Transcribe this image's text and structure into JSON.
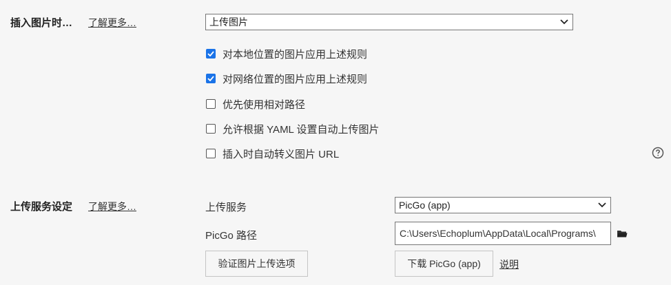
{
  "insert_image": {
    "title": "插入图片时…",
    "learn_more": "了解更多…",
    "action_select": {
      "selected": "上传图片"
    },
    "options": [
      {
        "label": "对本地位置的图片应用上述规则",
        "checked": true
      },
      {
        "label": "对网络位置的图片应用上述规则",
        "checked": true
      },
      {
        "label": "优先使用相对路径",
        "checked": false
      },
      {
        "label": "允许根据 YAML 设置自动上传图片",
        "checked": false
      },
      {
        "label": "插入时自动转义图片 URL",
        "checked": false
      }
    ],
    "help_icon": "question-circle-icon"
  },
  "upload_service": {
    "title": "上传服务设定",
    "learn_more": "了解更多…",
    "service_label": "上传服务",
    "service_select": {
      "selected": "PicGo (app)"
    },
    "path_label": "PicGo 路径",
    "path_value": "C:\\Users\\Echoplum\\AppData\\Local\\Programs\\",
    "folder_icon": "folder-icon",
    "verify_button": "验证图片上传选项",
    "download_button": "下载 PicGo (app)",
    "explain_link": "说明"
  },
  "colors": {
    "background": "#f6f6f6",
    "checkbox_accent": "#1a73e8"
  }
}
